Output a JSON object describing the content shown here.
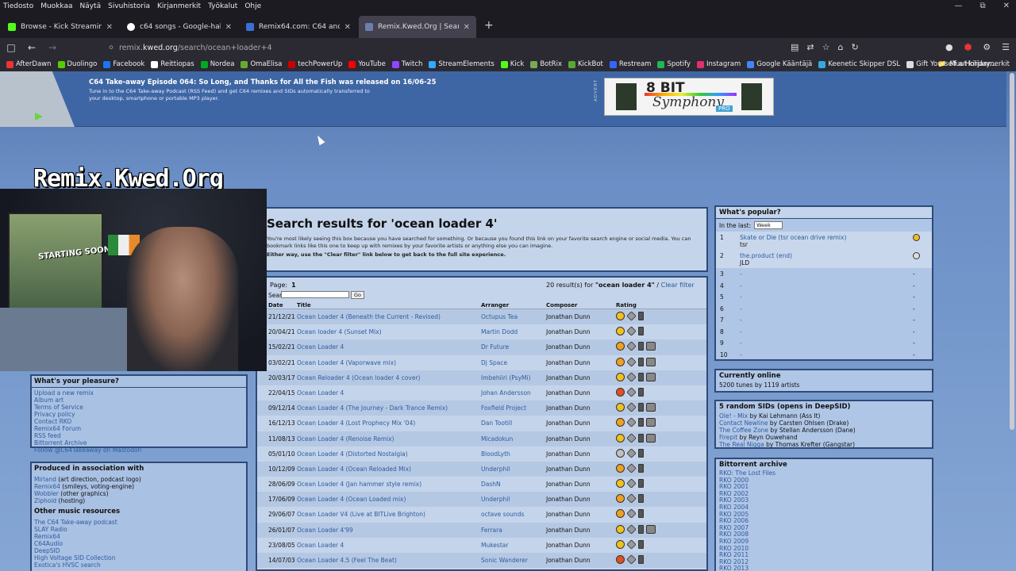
{
  "menubar": {
    "items": [
      "Tiedosto",
      "Muokkaa",
      "Näytä",
      "Sivuhistoria",
      "Kirjanmerkit",
      "Työkalut",
      "Ohje"
    ]
  },
  "tabs": [
    {
      "title": "Browse - Kick Streaming",
      "color": "#53fc18"
    },
    {
      "title": "c64 songs - Google-haku",
      "color": "#4285f4"
    },
    {
      "title": "Remix64.com: C64 and Amiga M",
      "color": "#3b6fd6"
    },
    {
      "title": "Remix.Kwed.Org | Search result",
      "color": "#6a7fb0"
    }
  ],
  "navbar": {
    "url_prefix": "remix.",
    "url_domain": "kwed.org",
    "url_path": "/search/ocean+loader+4"
  },
  "bookmarks": [
    "AfterDawn",
    "Duolingo",
    "Facebook",
    "Reittiopas",
    "Nordea",
    "OmaElisa",
    "techPowerUp",
    "YouTube",
    "Twitch",
    "StreamElements",
    "Kick",
    "BotRix",
    "KickBot",
    "Restream",
    "Spotify",
    "Instagram",
    "Google Kääntäjä",
    "Keenetic Skipper DSL",
    "Gift Yourself a Holiday..."
  ],
  "bookmarks_other": "Muut kirjanmerkit",
  "news": {
    "title": "C64 Take-away Episode 064: So Long, and Thanks for All the Fish was released on 16/06-25",
    "subtitle": "Tune in to the C64 Take-away Podcast (RSS Feed) and get C64 remixes and SIDs automatically transferred to your desktop, smartphone or portable MP3 player."
  },
  "advert": {
    "label": "ADVERT",
    "line1": "8 BIT",
    "line2": "Symphony",
    "line3": "PRO"
  },
  "site_logo": "Remix.Kwed.Org",
  "webcam": {
    "poster_text": "STARTING SOON"
  },
  "pleasure": {
    "title": "What's your pleasure?",
    "items": [
      "Upload a new remix",
      "Album art",
      "Terms of Service",
      "Privacy policy",
      "Contact RKO",
      "Remix64 Forum",
      "RSS feed",
      "Bittorrent Archive",
      "Follow @C64Takeaway on Mastodon"
    ]
  },
  "association": {
    "title": "Produced in association with",
    "items": [
      {
        "link": "Mirland",
        "rest": " (art direction, podcast logo)"
      },
      {
        "link": "Remix64",
        "rest": " (smileys, voting-engine)"
      },
      {
        "link": "Wobbler",
        "rest": " (other graphics)"
      },
      {
        "link": "Ziphoid",
        "rest": " (hosting)"
      }
    ],
    "other_title": "Other music resources",
    "other": [
      "The C64 Take-away podcast",
      "SLAY Radio",
      "Remix64",
      "C64Audio",
      "DeepSID",
      "High Voltage SID Collection",
      "Exotica's HVSC search"
    ]
  },
  "main": {
    "heading": "Search results for 'ocean loader 4'",
    "intro": "You're most likely seeing this box because you have searched for something. Or because you found this link on your favorite search engine or social media. You can bookmark links like this one to keep up with remixes by your favorite artists or anything else you can imagine.",
    "intro_bold": "Either way, use the \"Clear filter\" link below to get back to the full site experience."
  },
  "results": {
    "page_label": "Page:",
    "page_num": "1",
    "count_text": "20 result(s) for ",
    "query": "\"ocean loader 4\"",
    "sep": " / ",
    "clear": "Clear filter",
    "search_label": "Search:",
    "go": "Go",
    "headers": {
      "date": "Date",
      "title": "Title",
      "arranger": "Arranger",
      "composer": "Composer",
      "rating": "Rating"
    },
    "rows": [
      {
        "date": "21/12/21",
        "title": "Ocean Loader 4 (Beneath the Current - Revised)",
        "arranger": "Octupus Tea",
        "composer": "Jonathan Dunn",
        "rating_color": "#f0c020",
        "cplay": false
      },
      {
        "date": "20/04/21",
        "title": "Ocean loader 4 (Sunset Mix)",
        "arranger": "Martin Dodd",
        "composer": "Jonathan Dunn",
        "rating_color": "#f0c020",
        "cplay": false
      },
      {
        "date": "15/02/21",
        "title": "Ocean Loader 4",
        "arranger": "Dr Future",
        "composer": "Jonathan Dunn",
        "rating_color": "#f0a020",
        "cplay": true
      },
      {
        "date": "03/02/21",
        "title": "Ocean Loader 4 (Vaporwave mix)",
        "arranger": "Dj Space",
        "composer": "Jonathan Dunn",
        "rating_color": "#f0a020",
        "cplay": true
      },
      {
        "date": "20/03/17",
        "title": "Ocean Reloader 4 (Ocean loader 4 cover)",
        "arranger": "Imbehiiri (PsyMi)",
        "composer": "Jonathan Dunn",
        "rating_color": "#f0c020",
        "cplay": true
      },
      {
        "date": "22/04/15",
        "title": "Ocean Loader 4",
        "arranger": "Johan Andersson",
        "composer": "Jonathan Dunn",
        "rating_color": "#e05020",
        "cplay": false
      },
      {
        "date": "09/12/14",
        "title": "Ocean Loader 4 (The Journey - Dark Trance Remix)",
        "arranger": "Foxfield Project",
        "composer": "Jonathan Dunn",
        "rating_color": "#f0c020",
        "cplay": true
      },
      {
        "date": "16/12/13",
        "title": "Ocean Loader 4 (Lost Prophecy Mix '04)",
        "arranger": "Dan Tootill",
        "composer": "Jonathan Dunn",
        "rating_color": "#f0a020",
        "cplay": true
      },
      {
        "date": "11/08/13",
        "title": "Ocean Loader 4 (Renoise Remix)",
        "arranger": "Micadokun",
        "composer": "Jonathan Dunn",
        "rating_color": "#f0c020",
        "cplay": true
      },
      {
        "date": "05/01/10",
        "title": "Ocean Loader 4 (Distorted Nostalgia)",
        "arranger": "BloodLyth",
        "composer": "Jonathan Dunn",
        "rating_color": "#c0c0c0",
        "cplay": false
      },
      {
        "date": "10/12/09",
        "title": "Ocean Loader 4 (Ocean Reloaded Mix)",
        "arranger": "Underphil",
        "composer": "Jonathan Dunn",
        "rating_color": "#f0a020",
        "cplay": false
      },
      {
        "date": "28/06/09",
        "title": "Ocean Loader 4 (Jan hammer style remix)",
        "arranger": "DashN",
        "composer": "Jonathan Dunn",
        "rating_color": "#f0c020",
        "cplay": false
      },
      {
        "date": "17/06/09",
        "title": "Ocean Loader 4 (Ocean Loaded mix)",
        "arranger": "Underphil",
        "composer": "Jonathan Dunn",
        "rating_color": "#f0a020",
        "cplay": false
      },
      {
        "date": "29/06/07",
        "title": "Ocean Loader V4 (Live at BITLive Brighton)",
        "arranger": "octave sounds",
        "composer": "Jonathan Dunn",
        "rating_color": "#f0a020",
        "cplay": false
      },
      {
        "date": "26/01/07",
        "title": "Ocean Loader 4'99",
        "arranger": "Ferrara",
        "composer": "Jonathan Dunn",
        "rating_color": "#f0c020",
        "cplay": true
      },
      {
        "date": "23/08/05",
        "title": "Ocean Loader 4",
        "arranger": "Mukestar",
        "composer": "Jonathan Dunn",
        "rating_color": "#f0c020",
        "cplay": false
      },
      {
        "date": "14/07/03",
        "title": "Ocean Loader 4.5 (Feel The Beat)",
        "arranger": "Sonic Wanderer",
        "composer": "Jonathan Dunn",
        "rating_color": "#e05020",
        "cplay": false
      }
    ]
  },
  "popular": {
    "title": "What's popular?",
    "in_last": "In the last:",
    "period": "Week",
    "items": [
      {
        "n": "1",
        "title": "Skate or Die (tsr ocean drive remix)",
        "artist": "tsr"
      },
      {
        "n": "2",
        "title": "the.product (end)",
        "artist": "JLD"
      },
      {
        "n": "3",
        "title": "-",
        "artist": "",
        "dash": "-"
      },
      {
        "n": "4",
        "title": "-",
        "artist": "",
        "dash": "-"
      },
      {
        "n": "5",
        "title": "-",
        "artist": "",
        "dash": "-"
      },
      {
        "n": "6",
        "title": "-",
        "artist": "",
        "dash": "-"
      },
      {
        "n": "7",
        "title": "-",
        "artist": "",
        "dash": "-"
      },
      {
        "n": "8",
        "title": "-",
        "artist": "",
        "dash": "-"
      },
      {
        "n": "9",
        "title": "-",
        "artist": "",
        "dash": "-"
      },
      {
        "n": "10",
        "title": "-",
        "artist": "",
        "dash": "-"
      }
    ]
  },
  "online": {
    "title": "Currently online",
    "text": "5200 tunes by 1119 artists"
  },
  "random": {
    "title": "5 random SIDs (opens in DeepSID)",
    "items": [
      {
        "t": "Ole! - Mix",
        "by": " by Kai Lehmann (Ass It)"
      },
      {
        "t": "Contact Newline",
        "by": " by Carsten Ohlsen (Drake)"
      },
      {
        "t": "The Coffee Zone",
        "by": " by Stellan Andersson (Dane)"
      },
      {
        "t": "Firepit",
        "by": " by Reyn Ouwehand"
      },
      {
        "t": "The Real Nigga",
        "by": " by Thomas Krefter (Gangstar)"
      }
    ]
  },
  "torrent": {
    "title": "Bittorrent archive",
    "items": [
      "RKO: The Lost Files",
      "RKO 2000",
      "RKO 2001",
      "RKO 2002",
      "RKO 2003",
      "RKO 2004",
      "RKO 2005",
      "RKO 2006",
      "RKO 2007",
      "RKO 2008",
      "RKO 2009",
      "RKO 2010",
      "RKO 2011",
      "RKO 2012",
      "RKO 2013"
    ]
  }
}
